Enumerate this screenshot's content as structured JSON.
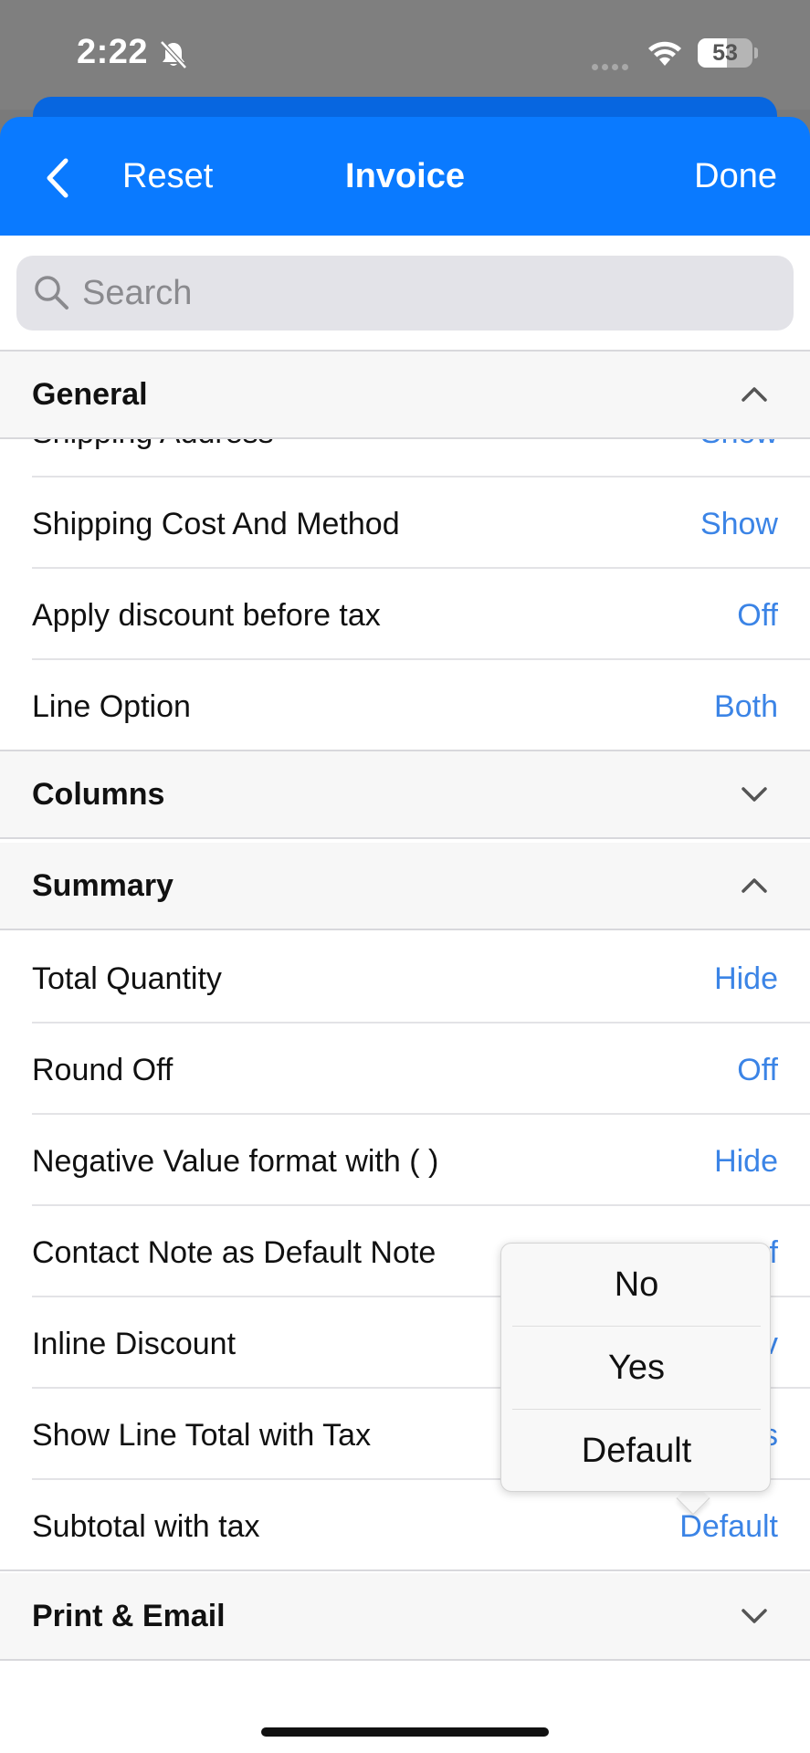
{
  "status_bar": {
    "time": "2:22",
    "battery": "53",
    "battery_level_percent": 53
  },
  "nav": {
    "reset_label": "Reset",
    "title": "Invoice",
    "done_label": "Done"
  },
  "search": {
    "placeholder": "Search"
  },
  "sections": {
    "general": {
      "label": "General",
      "rows": [
        {
          "label": "Shipping Address",
          "value": "Show"
        },
        {
          "label": "Shipping Cost And Method",
          "value": "Show"
        },
        {
          "label": "Apply discount before tax",
          "value": "Off"
        },
        {
          "label": "Line Option",
          "value": "Both"
        }
      ]
    },
    "columns": {
      "label": "Columns"
    },
    "summary": {
      "label": "Summary",
      "rows": [
        {
          "label": "Total Quantity",
          "value": "Hide"
        },
        {
          "label": "Round Off",
          "value": "Off"
        },
        {
          "label": "Negative Value format with ( )",
          "value": "Hide"
        },
        {
          "label": "Contact Note as Default Note",
          "value": "f"
        },
        {
          "label": "Inline Discount",
          "value": "v"
        },
        {
          "label": "Show Line Total with Tax",
          "value": "s"
        },
        {
          "label": "Subtotal with tax",
          "value": "Default"
        }
      ]
    },
    "print_email": {
      "label": "Print & Email"
    }
  },
  "popup": {
    "options": [
      "No",
      "Yes",
      "Default"
    ]
  },
  "colors": {
    "nav_blue": "#0a7aff",
    "value_blue": "#3b84e6"
  }
}
